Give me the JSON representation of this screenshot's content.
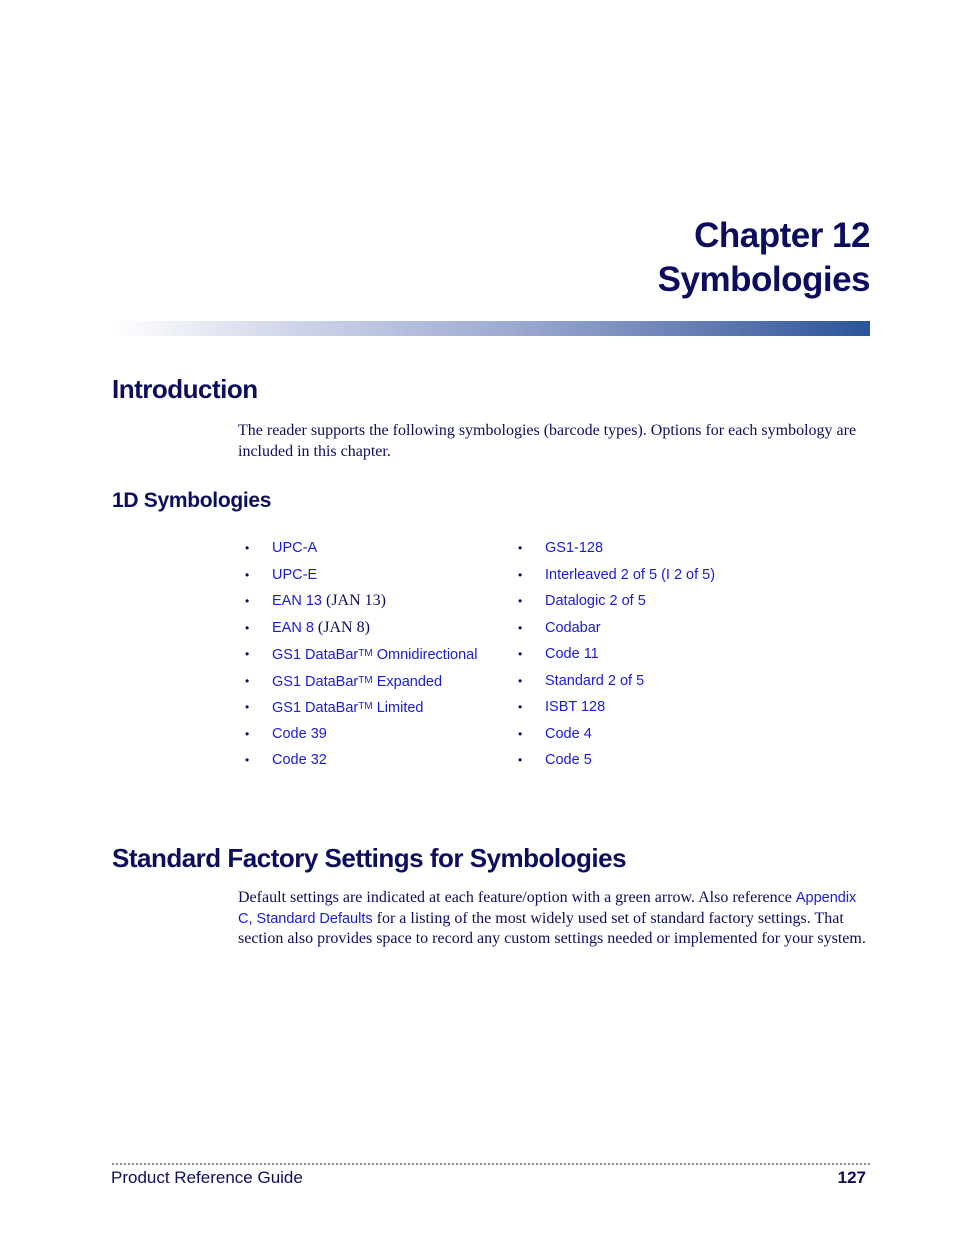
{
  "chapter": {
    "line1": "Chapter 12",
    "line2": "Symbologies"
  },
  "introduction": {
    "heading": "Introduction",
    "paragraph": "The reader supports the following symbologies (barcode types). Options for each symbology are included in this chapter."
  },
  "symbologies_1d": {
    "heading": "1D Symbologies",
    "left_column": [
      {
        "link": "UPC-A",
        "suffix": ""
      },
      {
        "link": "UPC-E",
        "suffix": ""
      },
      {
        "link": "EAN 13",
        "suffix": " (JAN 13)"
      },
      {
        "link": "EAN 8",
        "suffix": " (JAN 8)"
      },
      {
        "link_pre": "GS1 DataBar",
        "tm": "TM",
        "link_post": " Omnidirectional"
      },
      {
        "link_pre": "GS1 DataBar",
        "tm": "TM",
        "link_post": " Expanded"
      },
      {
        "link_pre": "GS1 DataBar",
        "tm": "TM",
        "link_post": " Limited"
      },
      {
        "link": "Code 39",
        "suffix": ""
      },
      {
        "link": "Code 32",
        "suffix": ""
      }
    ],
    "right_column": [
      {
        "link": "GS1-128"
      },
      {
        "link": "Interleaved 2 of 5 (I 2 of 5)"
      },
      {
        "link": "Datalogic 2 of 5"
      },
      {
        "link": "Codabar"
      },
      {
        "link": "Code 11"
      },
      {
        "link": "Standard 2 of 5"
      },
      {
        "link": "ISBT 128"
      },
      {
        "link": "Code 4"
      },
      {
        "link": "Code 5"
      }
    ],
    "bullet": "•"
  },
  "factory_settings": {
    "heading": "Standard Factory Settings for Symbologies",
    "text_before": "Default settings are indicated at each feature/option with a green arrow. Also reference ",
    "link": "Appendix C, Standard Defaults",
    "text_after": " for a listing of the most widely used set of standard factory settings. That section also provides space to record any custom settings needed or implemented for your system."
  },
  "footer": {
    "title": "Product Reference Guide",
    "page_number": "127"
  },
  "colors": {
    "heading": "#0d0d5e",
    "link": "#1a1adb",
    "bar_end": "#2a559a"
  }
}
